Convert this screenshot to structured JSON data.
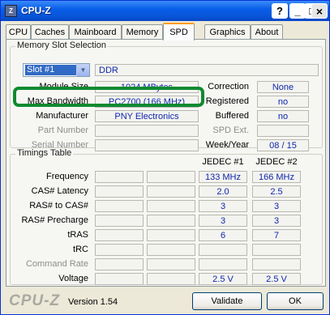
{
  "window": {
    "title": "CPU-Z",
    "app_icon_text": "Z"
  },
  "title_buttons": {
    "help": "?",
    "minimize": "_",
    "maximize": "□",
    "close": "×"
  },
  "tabs": [
    "CPU",
    "Caches",
    "Mainboard",
    "Memory",
    "SPD",
    "Graphics",
    "About"
  ],
  "active_tab": "SPD",
  "memory_slot": {
    "legend": "Memory Slot Selection",
    "slot_selected": "Slot #1",
    "memory_type": "DDR",
    "labels": {
      "module_size": "Module Size",
      "max_bandwidth": "Max Bandwidth",
      "manufacturer": "Manufacturer",
      "part_number": "Part Number",
      "serial_number": "Serial Number",
      "correction": "Correction",
      "registered": "Registered",
      "buffered": "Buffered",
      "spd_ext": "SPD Ext.",
      "week_year": "Week/Year"
    },
    "values": {
      "module_size": "1024 MBytes",
      "max_bandwidth": "PC2700 (166 MHz)",
      "manufacturer": "PNY Electronics",
      "part_number": "",
      "serial_number": "",
      "correction": "None",
      "registered": "no",
      "buffered": "no",
      "spd_ext": "",
      "week_year": "08 / 15"
    }
  },
  "timings": {
    "legend": "Timings Table",
    "headers": [
      "JEDEC #1",
      "JEDEC #2"
    ],
    "rows": [
      {
        "label": "Frequency",
        "j1": "133 MHz",
        "j2": "166 MHz",
        "dim": false
      },
      {
        "label": "CAS# Latency",
        "j1": "2.0",
        "j2": "2.5",
        "dim": false
      },
      {
        "label": "RAS# to CAS#",
        "j1": "3",
        "j2": "3",
        "dim": false
      },
      {
        "label": "RAS# Precharge",
        "j1": "3",
        "j2": "3",
        "dim": false
      },
      {
        "label": "tRAS",
        "j1": "6",
        "j2": "7",
        "dim": false
      },
      {
        "label": "tRC",
        "j1": "",
        "j2": "",
        "dim": false
      },
      {
        "label": "Command Rate",
        "j1": "",
        "j2": "",
        "dim": true
      },
      {
        "label": "Voltage",
        "j1": "2.5 V",
        "j2": "2.5 V",
        "dim": false
      }
    ]
  },
  "footer": {
    "logo": "CPU-Z",
    "version": "Version 1.54",
    "validate_label": "Validate",
    "ok_label": "OK"
  }
}
